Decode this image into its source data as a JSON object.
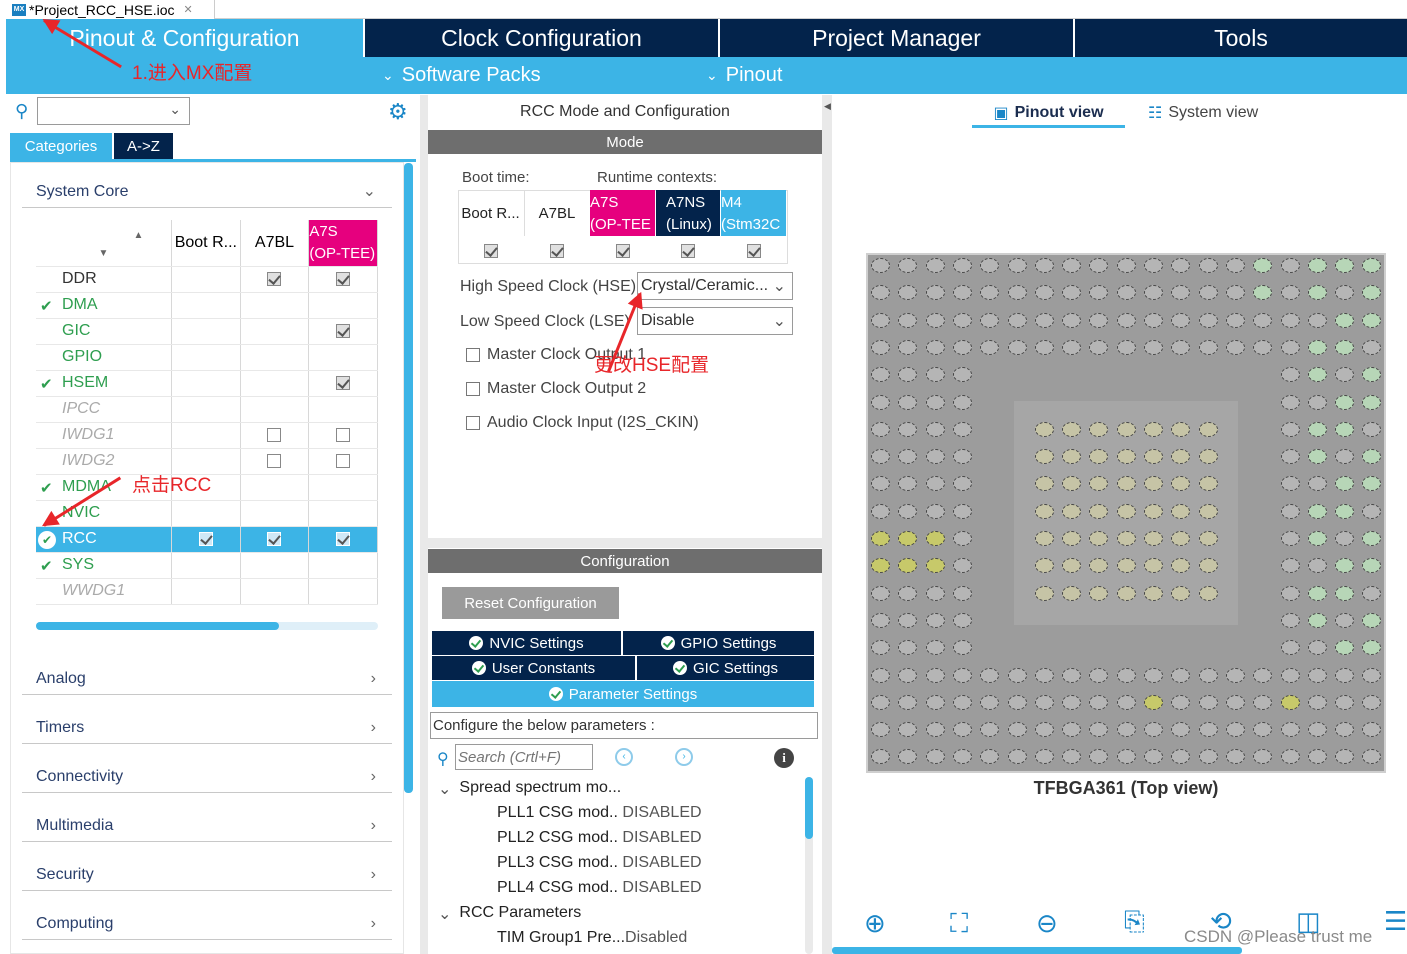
{
  "file_tab": {
    "title": "*Project_RCC_HSE.ioc",
    "icon": "MX"
  },
  "nav": {
    "tabs": [
      "Pinout & Configuration",
      "Clock Configuration",
      "Project Manager",
      "Tools"
    ],
    "subnav": [
      "Software Packs",
      "Pinout"
    ]
  },
  "left": {
    "cat_tabs": [
      "Categories",
      "A->Z"
    ],
    "group_title": "System Core",
    "col_headers": [
      "Boot R...",
      "A7BL",
      "A7S\n(OP-TEE)"
    ],
    "col_a7s_line1": "A7S",
    "col_a7s_line2": "(OP-TEE)",
    "rows": [
      "DDR",
      "DMA",
      "GIC",
      "GPIO",
      "HSEM",
      "IPCC",
      "IWDG1",
      "IWDG2",
      "MDMA",
      "NVIC",
      "RCC",
      "SYS",
      "WWDG1"
    ],
    "groups": [
      "Analog",
      "Timers",
      "Connectivity",
      "Multimedia",
      "Security",
      "Computing"
    ]
  },
  "middle": {
    "header": "RCC Mode and Configuration",
    "mode_bar": "Mode",
    "boot_time": "Boot time:",
    "runtime_contexts": "Runtime contexts:",
    "ctx": {
      "boot": "Boot R...",
      "a7bl": "A7BL",
      "a7s_1": "A7S",
      "a7s_2": "(OP-TEE",
      "a7ns_1": "A7NS",
      "a7ns_2": "(Linux)",
      "m4_1": "M4",
      "m4_2": "(Stm32C"
    },
    "hse_label": "High Speed Clock (HSE)",
    "hse_value": "Crystal/Ceramic...",
    "lse_label": "Low Speed Clock (LSE)",
    "lse_value": "Disable",
    "mco1": "Master Clock Output 1",
    "mco2": "Master Clock Output 2",
    "i2s": "Audio Clock Input (I2S_CKIN)",
    "config_bar": "Configuration",
    "reset_btn": "Reset Configuration",
    "tabs": [
      "NVIC Settings",
      "GPIO Settings",
      "User Constants",
      "GIC Settings",
      "Parameter Settings"
    ],
    "configure_text": "Configure the below parameters :",
    "search_placeholder": "Search (Crtl+F)",
    "param_groups": [
      "Spread spectrum mo...",
      "RCC Parameters"
    ],
    "params": [
      {
        "name": "PLL1 CSG mod..",
        "value": "DISABLED"
      },
      {
        "name": "PLL2 CSG mod..",
        "value": "DISABLED"
      },
      {
        "name": "PLL3 CSG mod..",
        "value": "DISABLED"
      },
      {
        "name": "PLL4 CSG mod..",
        "value": "DISABLED"
      },
      {
        "name": "TIM Group1 Pre...",
        "value": "Disabled"
      }
    ]
  },
  "right": {
    "views": [
      "Pinout view",
      "System view"
    ],
    "chip_label": "TFBGA361 (Top view)",
    "watermark": "CSDN @Please trust me"
  },
  "annotations": {
    "enter_mx": "1.进入MX配置",
    "click_rcc": "点击RCC",
    "change_hse": "更改HSE配置"
  },
  "colors": {
    "nav_dark": "#03234b",
    "accent": "#3cb4e6",
    "ok_green": "#2e9e4f",
    "annotation_red": "#e8262a",
    "a7s_pink": "#e6007e"
  }
}
